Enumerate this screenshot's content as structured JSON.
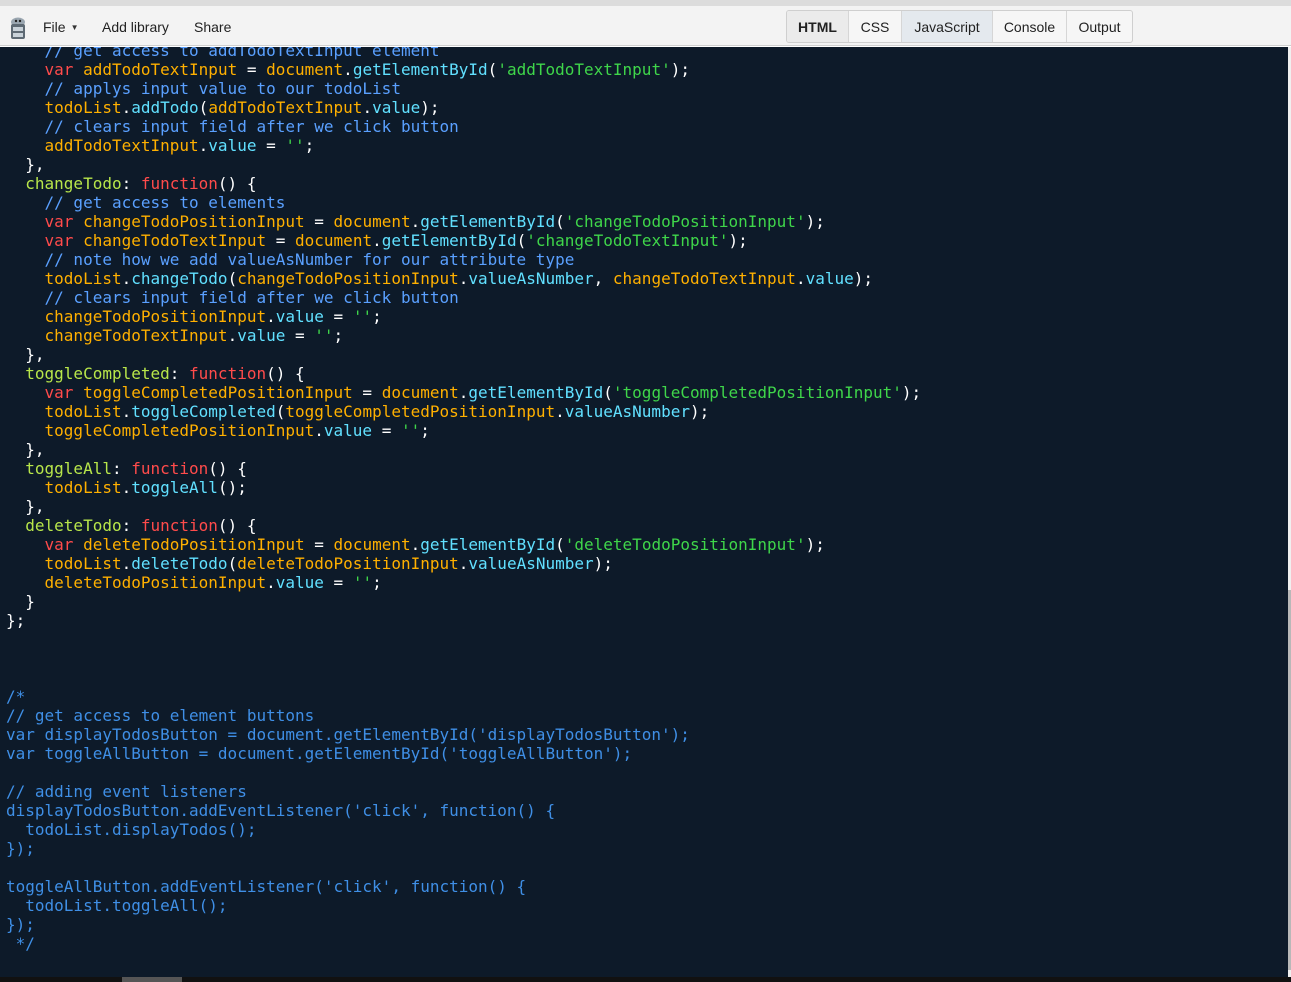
{
  "menubar": {
    "file": "File",
    "add_library": "Add library",
    "share": "Share"
  },
  "panel_tabs": [
    {
      "label": "HTML",
      "name": "tab-html"
    },
    {
      "label": "CSS",
      "name": "tab-css"
    },
    {
      "label": "JavaScript",
      "name": "tab-javascript"
    },
    {
      "label": "Console",
      "name": "tab-console"
    },
    {
      "label": "Output",
      "name": "tab-output"
    }
  ],
  "icons": {
    "logo": "jsbin-logo-icon",
    "caret": "chevron-down-icon"
  },
  "colors": {
    "editor_bg": "#0d1a29",
    "keyword": "#ff4b4b",
    "variable": "#ffb000",
    "function": "#61e0ff",
    "string": "#3fd64a",
    "comment": "#5aa0ff",
    "block_comment": "#3f8fe6"
  },
  "editor": {
    "lines": [
      {
        "i": "    ",
        "t": [
          [
            "// get access to addTodoTextInput element",
            "cmt"
          ]
        ]
      },
      {
        "i": "    ",
        "t": [
          [
            "var",
            "kw"
          ],
          [
            " ",
            ""
          ],
          [
            "addTodoTextInput",
            "var"
          ],
          [
            " = ",
            "pun"
          ],
          [
            "document",
            "var"
          ],
          [
            ".",
            "pun"
          ],
          [
            "getElementById",
            "fn"
          ],
          [
            "(",
            "pun"
          ],
          [
            "'addTodoTextInput'",
            "str"
          ],
          [
            ");",
            "pun"
          ]
        ]
      },
      {
        "i": "    ",
        "t": [
          [
            "// applys input value to our todoList",
            "cmt"
          ]
        ]
      },
      {
        "i": "    ",
        "t": [
          [
            "todoList",
            "var"
          ],
          [
            ".",
            "pun"
          ],
          [
            "addTodo",
            "fn"
          ],
          [
            "(",
            "pun"
          ],
          [
            "addTodoTextInput",
            "var"
          ],
          [
            ".",
            "pun"
          ],
          [
            "value",
            "fn"
          ],
          [
            ");",
            "pun"
          ]
        ]
      },
      {
        "i": "    ",
        "t": [
          [
            "// clears input field after we click button",
            "cmt"
          ]
        ]
      },
      {
        "i": "    ",
        "t": [
          [
            "addTodoTextInput",
            "var"
          ],
          [
            ".",
            "pun"
          ],
          [
            "value",
            "fn"
          ],
          [
            " = ",
            "pun"
          ],
          [
            "''",
            "str"
          ],
          [
            ";",
            "pun"
          ]
        ]
      },
      {
        "i": "  ",
        "t": [
          [
            "},",
            "pun"
          ]
        ]
      },
      {
        "i": "  ",
        "t": [
          [
            "changeTodo",
            "prop"
          ],
          [
            ": ",
            "pun"
          ],
          [
            "function",
            "kw"
          ],
          [
            "() {",
            "pun"
          ]
        ]
      },
      {
        "i": "    ",
        "t": [
          [
            "// get access to elements",
            "cmt"
          ]
        ]
      },
      {
        "i": "    ",
        "t": [
          [
            "var",
            "kw"
          ],
          [
            " ",
            ""
          ],
          [
            "changeTodoPositionInput",
            "var"
          ],
          [
            " = ",
            "pun"
          ],
          [
            "document",
            "var"
          ],
          [
            ".",
            "pun"
          ],
          [
            "getElementById",
            "fn"
          ],
          [
            "(",
            "pun"
          ],
          [
            "'changeTodoPositionInput'",
            "str"
          ],
          [
            ");",
            "pun"
          ]
        ]
      },
      {
        "i": "    ",
        "t": [
          [
            "var",
            "kw"
          ],
          [
            " ",
            ""
          ],
          [
            "changeTodoTextInput",
            "var"
          ],
          [
            " = ",
            "pun"
          ],
          [
            "document",
            "var"
          ],
          [
            ".",
            "pun"
          ],
          [
            "getElementById",
            "fn"
          ],
          [
            "(",
            "pun"
          ],
          [
            "'changeTodoTextInput'",
            "str"
          ],
          [
            ");",
            "pun"
          ]
        ]
      },
      {
        "i": "    ",
        "t": [
          [
            "// note how we add valueAsNumber for our attribute type",
            "cmt"
          ]
        ]
      },
      {
        "i": "    ",
        "t": [
          [
            "todoList",
            "var"
          ],
          [
            ".",
            "pun"
          ],
          [
            "changeTodo",
            "fn"
          ],
          [
            "(",
            "pun"
          ],
          [
            "changeTodoPositionInput",
            "var"
          ],
          [
            ".",
            "pun"
          ],
          [
            "valueAsNumber",
            "fn"
          ],
          [
            ", ",
            "pun"
          ],
          [
            "changeTodoTextInput",
            "var"
          ],
          [
            ".",
            "pun"
          ],
          [
            "value",
            "fn"
          ],
          [
            ");",
            "pun"
          ]
        ]
      },
      {
        "i": "    ",
        "t": [
          [
            "// clears input field after we click button",
            "cmt"
          ]
        ]
      },
      {
        "i": "    ",
        "t": [
          [
            "changeTodoPositionInput",
            "var"
          ],
          [
            ".",
            "pun"
          ],
          [
            "value",
            "fn"
          ],
          [
            " = ",
            "pun"
          ],
          [
            "''",
            "str"
          ],
          [
            ";",
            "pun"
          ]
        ]
      },
      {
        "i": "    ",
        "t": [
          [
            "changeTodoTextInput",
            "var"
          ],
          [
            ".",
            "pun"
          ],
          [
            "value",
            "fn"
          ],
          [
            " = ",
            "pun"
          ],
          [
            "''",
            "str"
          ],
          [
            ";",
            "pun"
          ]
        ]
      },
      {
        "i": "  ",
        "t": [
          [
            "},",
            "pun"
          ]
        ]
      },
      {
        "i": "  ",
        "t": [
          [
            "toggleCompleted",
            "prop"
          ],
          [
            ": ",
            "pun"
          ],
          [
            "function",
            "kw"
          ],
          [
            "() {",
            "pun"
          ]
        ]
      },
      {
        "i": "    ",
        "t": [
          [
            "var",
            "kw"
          ],
          [
            " ",
            ""
          ],
          [
            "toggleCompletedPositionInput",
            "var"
          ],
          [
            " = ",
            "pun"
          ],
          [
            "document",
            "var"
          ],
          [
            ".",
            "pun"
          ],
          [
            "getElementById",
            "fn"
          ],
          [
            "(",
            "pun"
          ],
          [
            "'toggleCompletedPositionInput'",
            "str"
          ],
          [
            ");",
            "pun"
          ]
        ]
      },
      {
        "i": "    ",
        "t": [
          [
            "todoList",
            "var"
          ],
          [
            ".",
            "pun"
          ],
          [
            "toggleCompleted",
            "fn"
          ],
          [
            "(",
            "pun"
          ],
          [
            "toggleCompletedPositionInput",
            "var"
          ],
          [
            ".",
            "pun"
          ],
          [
            "valueAsNumber",
            "fn"
          ],
          [
            ");",
            "pun"
          ]
        ]
      },
      {
        "i": "    ",
        "t": [
          [
            "toggleCompletedPositionInput",
            "var"
          ],
          [
            ".",
            "pun"
          ],
          [
            "value",
            "fn"
          ],
          [
            " = ",
            "pun"
          ],
          [
            "''",
            "str"
          ],
          [
            ";",
            "pun"
          ]
        ]
      },
      {
        "i": "  ",
        "t": [
          [
            "},",
            "pun"
          ]
        ]
      },
      {
        "i": "  ",
        "t": [
          [
            "toggleAll",
            "prop"
          ],
          [
            ": ",
            "pun"
          ],
          [
            "function",
            "kw"
          ],
          [
            "() {",
            "pun"
          ]
        ]
      },
      {
        "i": "    ",
        "t": [
          [
            "todoList",
            "var"
          ],
          [
            ".",
            "pun"
          ],
          [
            "toggleAll",
            "fn"
          ],
          [
            "();",
            "pun"
          ]
        ]
      },
      {
        "i": "  ",
        "t": [
          [
            "},",
            "pun"
          ]
        ]
      },
      {
        "i": "  ",
        "t": [
          [
            "deleteTodo",
            "prop"
          ],
          [
            ": ",
            "pun"
          ],
          [
            "function",
            "kw"
          ],
          [
            "() {",
            "pun"
          ]
        ]
      },
      {
        "i": "    ",
        "t": [
          [
            "var",
            "kw"
          ],
          [
            " ",
            ""
          ],
          [
            "deleteTodoPositionInput",
            "var"
          ],
          [
            " = ",
            "pun"
          ],
          [
            "document",
            "var"
          ],
          [
            ".",
            "pun"
          ],
          [
            "getElementById",
            "fn"
          ],
          [
            "(",
            "pun"
          ],
          [
            "'deleteTodoPositionInput'",
            "str"
          ],
          [
            ");",
            "pun"
          ]
        ]
      },
      {
        "i": "    ",
        "t": [
          [
            "todoList",
            "var"
          ],
          [
            ".",
            "pun"
          ],
          [
            "deleteTodo",
            "fn"
          ],
          [
            "(",
            "pun"
          ],
          [
            "deleteTodoPositionInput",
            "var"
          ],
          [
            ".",
            "pun"
          ],
          [
            "valueAsNumber",
            "fn"
          ],
          [
            ");",
            "pun"
          ]
        ]
      },
      {
        "i": "    ",
        "t": [
          [
            "deleteTodoPositionInput",
            "var"
          ],
          [
            ".",
            "pun"
          ],
          [
            "value",
            "fn"
          ],
          [
            " = ",
            "pun"
          ],
          [
            "''",
            "str"
          ],
          [
            ";",
            "pun"
          ]
        ]
      },
      {
        "i": "  ",
        "t": [
          [
            "}",
            "pun"
          ]
        ]
      },
      {
        "i": "",
        "t": [
          [
            "};",
            "pun"
          ]
        ]
      },
      {
        "i": "",
        "t": []
      },
      {
        "i": "",
        "t": []
      },
      {
        "i": "",
        "t": []
      },
      {
        "i": "",
        "t": [
          [
            "/*",
            "blk"
          ]
        ]
      },
      {
        "i": "",
        "t": [
          [
            "// get access to element buttons",
            "blk"
          ]
        ]
      },
      {
        "i": "",
        "t": [
          [
            "var displayTodosButton = document.getElementById('displayTodosButton');",
            "blk"
          ]
        ]
      },
      {
        "i": "",
        "t": [
          [
            "var toggleAllButton = document.getElementById('toggleAllButton');",
            "blk"
          ]
        ]
      },
      {
        "i": "",
        "t": []
      },
      {
        "i": "",
        "t": [
          [
            "// adding event listeners",
            "blk"
          ]
        ]
      },
      {
        "i": "",
        "t": [
          [
            "displayTodosButton.addEventListener('click', function() {",
            "blk"
          ]
        ]
      },
      {
        "i": "  ",
        "t": [
          [
            "todoList.displayTodos();",
            "blk"
          ]
        ]
      },
      {
        "i": "",
        "t": [
          [
            "});",
            "blk"
          ]
        ]
      },
      {
        "i": "",
        "t": []
      },
      {
        "i": "",
        "t": [
          [
            "toggleAllButton.addEventListener('click', function() {",
            "blk"
          ]
        ]
      },
      {
        "i": "  ",
        "t": [
          [
            "todoList.toggleAll();",
            "blk"
          ]
        ]
      },
      {
        "i": "",
        "t": [
          [
            "});",
            "blk"
          ]
        ]
      },
      {
        "i": " ",
        "t": [
          [
            "*/",
            "blk"
          ]
        ]
      }
    ]
  }
}
